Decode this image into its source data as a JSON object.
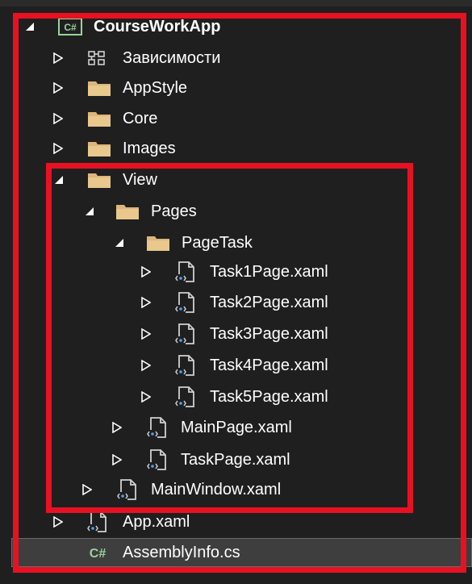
{
  "solution_explorer": {
    "project": {
      "label": "CourseWorkApp",
      "badge": "C#"
    },
    "nodes": {
      "dependencies": "Зависимости",
      "appstyle": "AppStyle",
      "core": "Core",
      "images": "Images",
      "view": "View",
      "pages": "Pages",
      "pagetask": "PageTask",
      "task1": "Task1Page.xaml",
      "task2": "Task2Page.xaml",
      "task3": "Task3Page.xaml",
      "task4": "Task4Page.xaml",
      "task5": "Task5Page.xaml",
      "mainpage": "MainPage.xaml",
      "taskpage": "TaskPage.xaml",
      "mainwindow": "MainWindow.xaml",
      "app": "App.xaml",
      "assemblyinfo": "AssemblyInfo.cs"
    },
    "cs_file_badge": "C#",
    "selected_item": "AssemblyInfo.cs"
  },
  "colors": {
    "highlight": "#e81123",
    "folder": "#dcb67a",
    "project_badge": "#6aa84f",
    "csharp_badge": "#9bd39b",
    "xaml_accent": "#4aa3ff",
    "background": "#1f1f1f",
    "selection": "#3e3e3e"
  },
  "icons": {
    "expanded": "triangle-expanded-icon",
    "collapsed": "triangle-collapsed-icon",
    "folder": "folder-icon",
    "xaml_file": "xaml-file-icon",
    "dependencies": "dependencies-icon",
    "project": "csharp-project-icon",
    "csharp_file": "csharp-file-icon"
  }
}
